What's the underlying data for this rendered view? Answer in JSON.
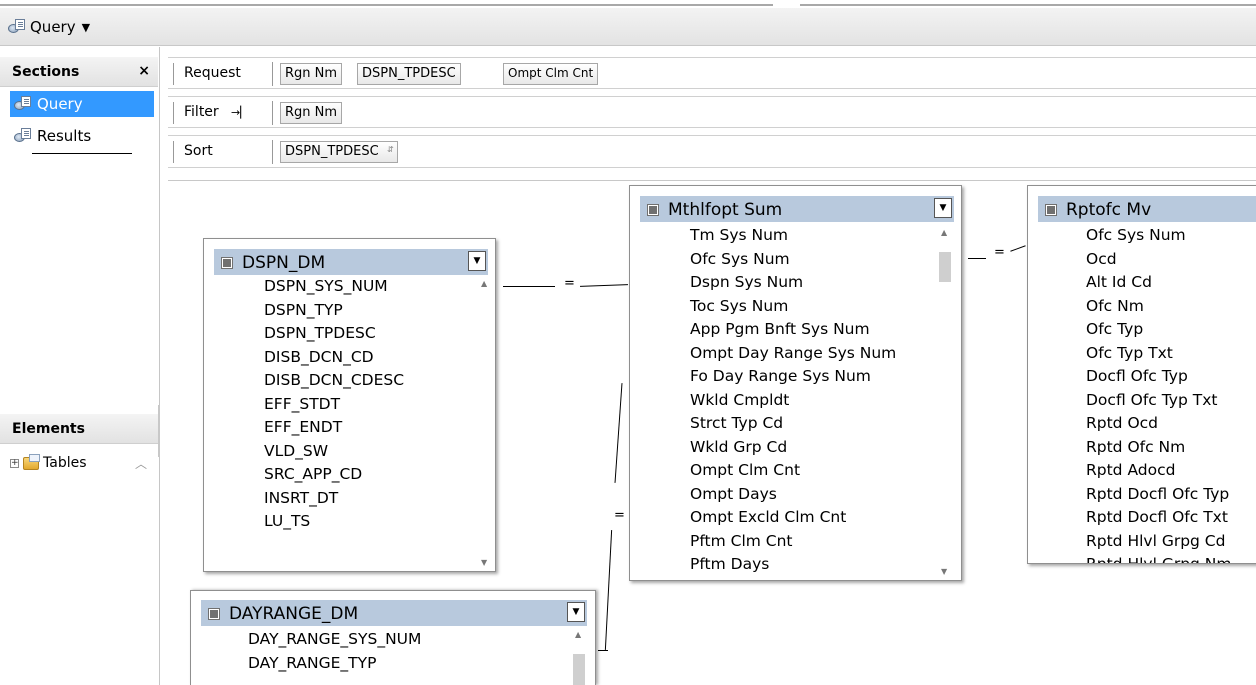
{
  "toolbar": {
    "query_label": "Query"
  },
  "sections": {
    "title": "Sections",
    "close_glyph": "×",
    "items": [
      {
        "label": "Query",
        "selected": true,
        "icon": "query-icon"
      },
      {
        "label": "Results",
        "selected": false,
        "icon": "results-icon"
      }
    ]
  },
  "elements": {
    "title": "Elements",
    "tree_items": [
      {
        "label": "Tables",
        "icon": "folder-icon"
      }
    ]
  },
  "query_panel": {
    "request": {
      "label": "Request",
      "items": [
        "Rgn Nm",
        "DSPN_TPDESC",
        "Ompt Clm Cnt"
      ]
    },
    "filter": {
      "label": "Filter",
      "items": [
        "Rgn Nm"
      ]
    },
    "sort": {
      "label": "Sort",
      "items": [
        "DSPN_TPDESC"
      ]
    }
  },
  "tables": {
    "dspn_dm": {
      "name": "DSPN_DM",
      "columns": [
        "DSPN_SYS_NUM",
        "DSPN_TYP",
        "DSPN_TPDESC",
        "DISB_DCN_CD",
        "DISB_DCN_CDESC",
        "EFF_STDT",
        "EFF_ENDT",
        "VLD_SW",
        "SRC_APP_CD",
        "INSRT_DT",
        "LU_TS"
      ]
    },
    "mthlfopt_sum": {
      "name": "Mthlfopt Sum",
      "columns": [
        "Tm Sys Num",
        "Ofc Sys Num",
        "Dspn Sys Num",
        "Toc Sys Num",
        "App Pgm Bnft Sys Num",
        "Ompt Day Range Sys Num",
        "Fo Day Range Sys Num",
        "Wkld Cmpldt",
        "Strct Typ Cd",
        "Wkld Grp Cd",
        "Ompt Clm Cnt",
        "Ompt Days",
        "Ompt Excld Clm Cnt",
        "Pftm Clm Cnt",
        "Pftm Days"
      ]
    },
    "rptofc_mv": {
      "name": "Rptofc Mv",
      "columns": [
        "Ofc Sys Num",
        "Ocd",
        "Alt Id Cd",
        "Ofc Nm",
        "Ofc Typ",
        "Ofc Typ Txt",
        "Docfl Ofc Typ",
        "Docfl Ofc Typ Txt",
        "Rptd Ocd",
        "Rptd Ofc Nm",
        "Rptd Adocd",
        "Rptd Docfl Ofc Typ",
        "Rptd Docfl Ofc Txt",
        "Rptd Hlvl Grpg Cd",
        "Rptd Hlvl Grpg Nm"
      ]
    },
    "dayrange_dm": {
      "name": "DAYRANGE_DM",
      "columns": [
        "DAY_RANGE_SYS_NUM",
        "DAY_RANGE_TYP"
      ]
    }
  },
  "joins": {
    "operator": "="
  }
}
